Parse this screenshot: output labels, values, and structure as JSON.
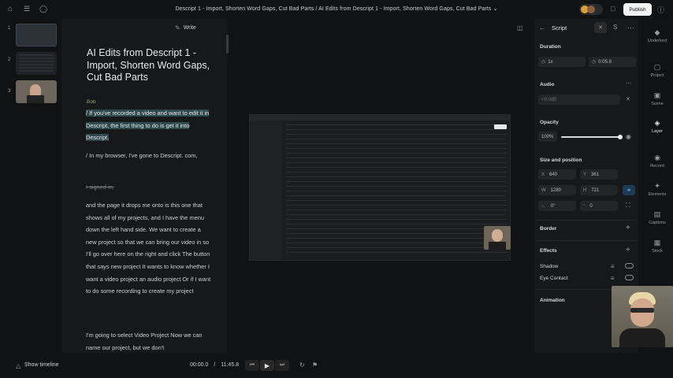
{
  "topbar": {
    "title": "Descript 1 - Import, Shorten Word Gaps, Cut Bad Parts  /  AI Edits from Descript 1 - Import, Shorten Word Gaps, Cut Bad Parts ⌄",
    "publish_label": "Publish"
  },
  "scenes": [
    {
      "num": "1"
    },
    {
      "num": "2"
    },
    {
      "num": "3"
    }
  ],
  "script": {
    "write_label": "Write",
    "title": "AI Edits from Descript 1 - Import, Shorten Word Gaps, Cut Bad Parts",
    "speaker": "Bob",
    "paragraphs": [
      "/ If you've recorded a video and want to edit it in Descript, the first thing to do is get it into Descript.",
      "/ In my browser, I've gone to Descript. com,",
      "I signed in,",
      "and the page it drops me onto is this one that shows all of my projects, and I have the menu down the left hand side. We want to create a new project so that we can bring our video in so I'll go over here on the right and click The button that says new project It wants to know whether I want a video project an audio project Or if I want to do some recording to create my project",
      "I'm going to select Video Project Now we can name our project, but we don't"
    ]
  },
  "bottombar": {
    "show_timeline": "Show timeline",
    "current_time": "00:00.0",
    "separator": "/",
    "total_time": "11:45.8"
  },
  "props": {
    "panel_title": "Script",
    "duration": {
      "title": "Duration",
      "speed": "1x",
      "length": "0:05.8"
    },
    "audio": {
      "title": "Audio",
      "gain": "+0.0dB"
    },
    "opacity": {
      "title": "Opacity",
      "value": "100%",
      "level": 1.0
    },
    "size_position": {
      "title": "Size and position",
      "x_label": "X",
      "x": "640",
      "y_label": "Y",
      "y": "361",
      "w_label": "W",
      "w": "1280",
      "h_label": "H",
      "h": "721",
      "rotation": "0°",
      "corner": "0"
    },
    "border": "Border",
    "effects": "Effects",
    "shadow": "Shadow",
    "eye_contact": "Eye Contact",
    "animation": "Animation"
  },
  "rail": [
    {
      "label": "Underlord",
      "icon": "underlord-icon"
    },
    {
      "label": "Project",
      "icon": "project-icon"
    },
    {
      "label": "Scene",
      "icon": "scene-icon"
    },
    {
      "label": "Layer",
      "icon": "layer-icon"
    },
    {
      "label": "Record",
      "icon": "record-icon"
    },
    {
      "label": "Elements",
      "icon": "elements-icon"
    },
    {
      "label": "Captions",
      "icon": "captions-icon"
    },
    {
      "label": "Stock",
      "icon": "stock-icon"
    }
  ],
  "colors": {
    "accent_highlight": "#2f4a4e",
    "speaker": "#8fae6a",
    "publish_bg": "#f2f2f2"
  }
}
